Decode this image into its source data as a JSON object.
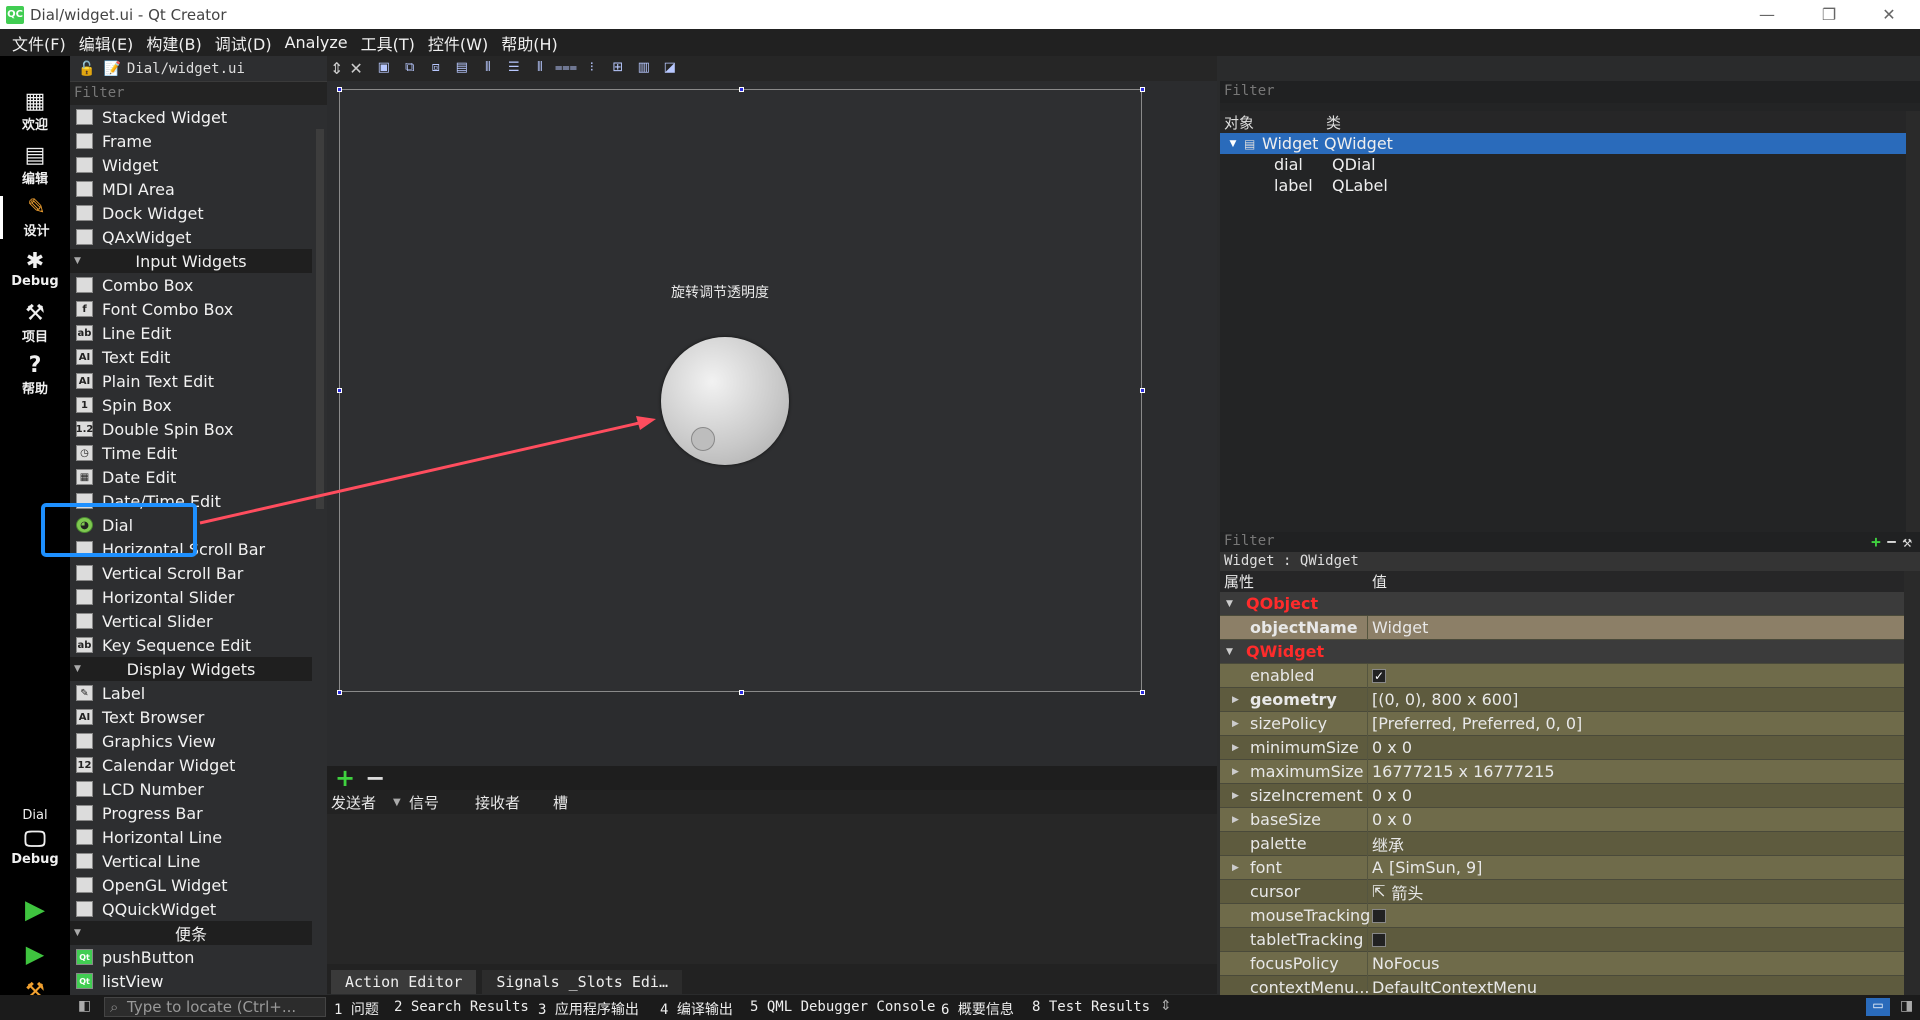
{
  "window": {
    "title": "Dial/widget.ui - Qt Creator",
    "logo": "QC"
  },
  "menu": [
    "文件(F)",
    "编辑(E)",
    "构建(B)",
    "调试(D)",
    "Analyze",
    "工具(T)",
    "控件(W)",
    "帮助(H)"
  ],
  "modes": [
    "欢迎",
    "编辑",
    "设计",
    "Debug",
    "项目",
    "帮助"
  ],
  "kit": {
    "project": "Dial",
    "config": "Debug"
  },
  "editor": {
    "file": "Dial/widget.ui"
  },
  "widgetbox": {
    "filter_placeholder": "Filter",
    "items": [
      {
        "type": "item",
        "label": "Stacked Widget",
        "icon": "stacked-widget-icon"
      },
      {
        "type": "item",
        "label": "Frame",
        "icon": "frame-icon"
      },
      {
        "type": "item",
        "label": "Widget",
        "icon": "widget-icon"
      },
      {
        "type": "item",
        "label": "MDI Area",
        "icon": "mdi-area-icon"
      },
      {
        "type": "item",
        "label": "Dock Widget",
        "icon": "dock-widget-icon"
      },
      {
        "type": "item",
        "label": "QAxWidget",
        "icon": "qaxwidget-icon"
      },
      {
        "type": "cat",
        "label": "Input Widgets"
      },
      {
        "type": "item",
        "label": "Combo Box",
        "icon": "combo-box-icon"
      },
      {
        "type": "item",
        "label": "Font Combo Box",
        "icon": "font-combo-box-icon"
      },
      {
        "type": "item",
        "label": "Line Edit",
        "icon": "line-edit-icon"
      },
      {
        "type": "item",
        "label": "Text Edit",
        "icon": "text-edit-icon"
      },
      {
        "type": "item",
        "label": "Plain Text Edit",
        "icon": "plain-text-edit-icon"
      },
      {
        "type": "item",
        "label": "Spin Box",
        "icon": "spin-box-icon"
      },
      {
        "type": "item",
        "label": "Double Spin Box",
        "icon": "double-spin-box-icon"
      },
      {
        "type": "item",
        "label": "Time Edit",
        "icon": "time-edit-icon"
      },
      {
        "type": "item",
        "label": "Date Edit",
        "icon": "date-edit-icon"
      },
      {
        "type": "item",
        "label": "Date/Time Edit",
        "icon": "date-time-edit-icon"
      },
      {
        "type": "item",
        "label": "Dial",
        "icon": "dial-icon"
      },
      {
        "type": "item",
        "label": "Horizontal Scroll Bar",
        "icon": "horizontal-scroll-bar-icon"
      },
      {
        "type": "item",
        "label": "Vertical Scroll Bar",
        "icon": "vertical-scroll-bar-icon"
      },
      {
        "type": "item",
        "label": "Horizontal Slider",
        "icon": "horizontal-slider-icon"
      },
      {
        "type": "item",
        "label": "Vertical Slider",
        "icon": "vertical-slider-icon"
      },
      {
        "type": "item",
        "label": "Key Sequence Edit",
        "icon": "key-sequence-edit-icon"
      },
      {
        "type": "cat",
        "label": "Display Widgets"
      },
      {
        "type": "item",
        "label": "Label",
        "icon": "label-icon"
      },
      {
        "type": "item",
        "label": "Text Browser",
        "icon": "text-browser-icon"
      },
      {
        "type": "item",
        "label": "Graphics View",
        "icon": "graphics-view-icon"
      },
      {
        "type": "item",
        "label": "Calendar Widget",
        "icon": "calendar-widget-icon"
      },
      {
        "type": "item",
        "label": "LCD Number",
        "icon": "lcd-number-icon"
      },
      {
        "type": "item",
        "label": "Progress Bar",
        "icon": "progress-bar-icon"
      },
      {
        "type": "item",
        "label": "Horizontal Line",
        "icon": "horizontal-line-icon"
      },
      {
        "type": "item",
        "label": "Vertical Line",
        "icon": "vertical-line-icon"
      },
      {
        "type": "item",
        "label": "OpenGL Widget",
        "icon": "opengl-widget-icon"
      },
      {
        "type": "item",
        "label": "QQuickWidget",
        "icon": "qquickwidget-icon"
      },
      {
        "type": "cat",
        "label": "便条"
      },
      {
        "type": "item",
        "label": "pushButton",
        "icon": "qt-icon"
      },
      {
        "type": "item",
        "label": "listView",
        "icon": "qt-icon"
      }
    ]
  },
  "form": {
    "label_text": "旋转调节透明度"
  },
  "signals": {
    "headers": [
      "发送者",
      "信号",
      "接收者",
      "槽"
    ],
    "tabs": [
      "Action Editor",
      "Signals _Slots Edi…"
    ]
  },
  "object_inspector": {
    "filter_placeholder": "Filter",
    "headers": [
      "对象",
      "类"
    ],
    "rows": [
      {
        "object": "Widget",
        "class": "QWidget",
        "selected": true
      },
      {
        "object": "dial",
        "class": "QDial"
      },
      {
        "object": "label",
        "class": "QLabel"
      }
    ]
  },
  "property_editor": {
    "filter_placeholder": "Filter",
    "title": "Widget : QWidget",
    "headers": [
      "属性",
      "值"
    ],
    "rows": [
      {
        "kind": "cat",
        "name": "QObject"
      },
      {
        "kind": "objname",
        "name": "objectName",
        "value": "Widget"
      },
      {
        "kind": "cat",
        "name": "QWidget"
      },
      {
        "kind": "prop",
        "name": "enabled",
        "value": "✓",
        "check": true
      },
      {
        "kind": "prop",
        "name": "geometry",
        "value": "[(0, 0), 800 x 600]",
        "expand": true,
        "bold": true
      },
      {
        "kind": "prop",
        "name": "sizePolicy",
        "value": "[Preferred, Preferred, 0, 0]",
        "expand": true
      },
      {
        "kind": "prop",
        "name": "minimumSize",
        "value": "0 x 0",
        "expand": true
      },
      {
        "kind": "prop",
        "name": "maximumSize",
        "value": "16777215 x 16777215",
        "expand": true
      },
      {
        "kind": "prop",
        "name": "sizeIncrement",
        "value": "0 x 0",
        "expand": true
      },
      {
        "kind": "prop",
        "name": "baseSize",
        "value": "0 x 0",
        "expand": true
      },
      {
        "kind": "prop",
        "name": "palette",
        "value": "继承"
      },
      {
        "kind": "prop",
        "name": "font",
        "value": "[SimSun, 9]",
        "prefix": "A",
        "expand": true
      },
      {
        "kind": "prop",
        "name": "cursor",
        "value": "箭头",
        "prefix": "⇱"
      },
      {
        "kind": "prop",
        "name": "mouseTracking",
        "value": "",
        "check": true
      },
      {
        "kind": "prop",
        "name": "tabletTracking",
        "value": "",
        "check": true
      },
      {
        "kind": "prop",
        "name": "focusPolicy",
        "value": "NoFocus"
      },
      {
        "kind": "prop",
        "name": "contextMenu...",
        "value": "DefaultContextMenu"
      }
    ]
  },
  "statusbar": {
    "locator_placeholder": "Type to locate (Ctrl+...",
    "outputs": [
      "1 问题",
      "2 Search Results",
      "3 应用程序输出",
      "4 编译输出",
      "5 QML Debugger Console",
      "6 概要信息",
      "8 Test Results"
    ]
  },
  "colors": {
    "annotation_box": "#1e90ff",
    "annotation_arrow": "#ff4d5e",
    "selection": "#2a6bbb",
    "category_text": "#ff2b2b"
  }
}
